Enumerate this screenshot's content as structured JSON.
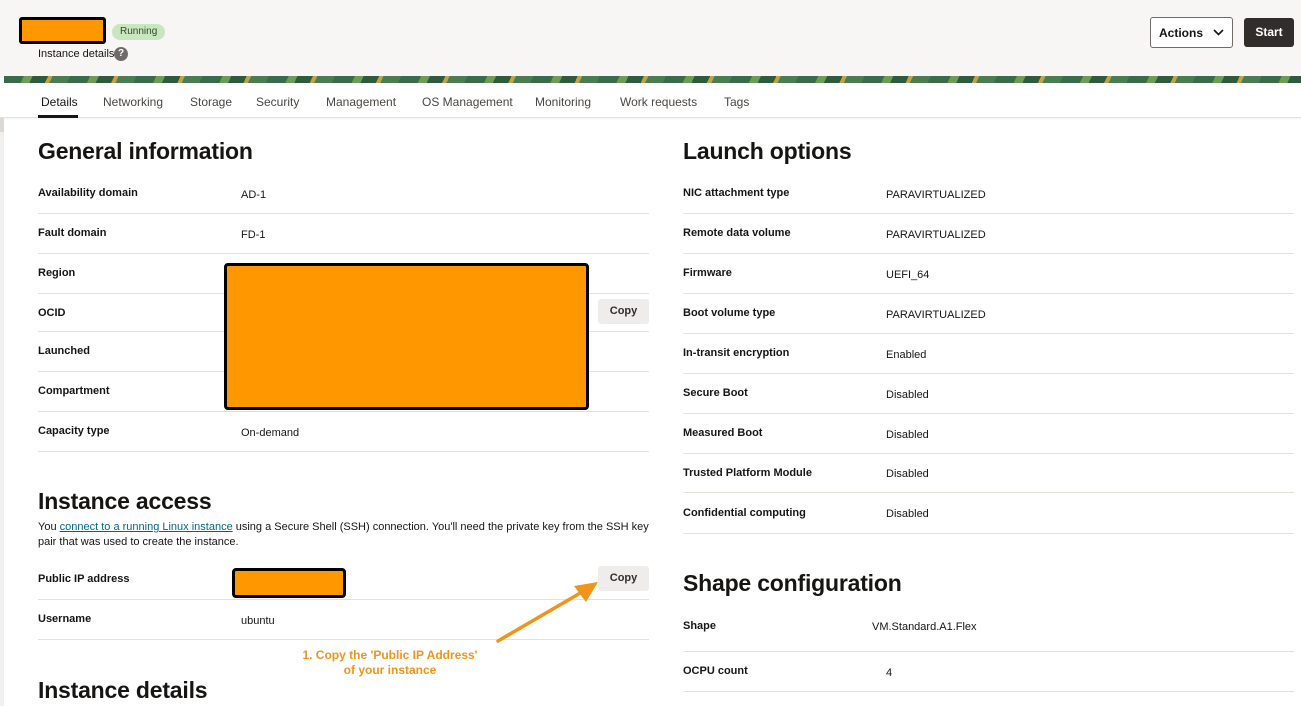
{
  "header": {
    "status": "Running",
    "subtitle": "Instance details",
    "help_glyph": "?",
    "actions_label": "Actions",
    "start_label": "Start"
  },
  "tabs": [
    "Details",
    "Networking",
    "Storage",
    "Security",
    "Management",
    "OS Management",
    "Monitoring",
    "Work requests",
    "Tags"
  ],
  "general": {
    "title": "General information",
    "rows": [
      {
        "label": "Availability domain",
        "value": "AD-1"
      },
      {
        "label": "Fault domain",
        "value": "FD-1"
      },
      {
        "label": "Region",
        "value": ""
      },
      {
        "label": "OCID",
        "value": ""
      },
      {
        "label": "Launched",
        "value": ""
      },
      {
        "label": "Compartment",
        "value": ""
      },
      {
        "label": "Capacity type",
        "value": "On-demand"
      }
    ],
    "copy_label": "Copy"
  },
  "access": {
    "title": "Instance access",
    "text_before": "You ",
    "link": "connect to a running Linux instance",
    "text_after": " using a Secure Shell (SSH) connection. You'll need the private key from the SSH key pair that was used to create the instance.",
    "rows": [
      {
        "label": "Public IP address",
        "value": ""
      },
      {
        "label": "Username",
        "value": "ubuntu"
      }
    ],
    "copy_label": "Copy"
  },
  "details_title": "Instance details",
  "launch": {
    "title": "Launch options",
    "rows": [
      {
        "label": "NIC attachment type",
        "value": "PARAVIRTUALIZED"
      },
      {
        "label": "Remote data volume",
        "value": "PARAVIRTUALIZED"
      },
      {
        "label": "Firmware",
        "value": "UEFI_64"
      },
      {
        "label": "Boot volume type",
        "value": "PARAVIRTUALIZED"
      },
      {
        "label": "In-transit encryption",
        "value": "Enabled"
      },
      {
        "label": "Secure Boot",
        "value": "Disabled"
      },
      {
        "label": "Measured Boot",
        "value": "Disabled"
      },
      {
        "label": "Trusted Platform Module",
        "value": "Disabled"
      },
      {
        "label": "Confidential computing",
        "value": "Disabled"
      }
    ]
  },
  "shape": {
    "title": "Shape configuration",
    "rows": [
      {
        "label": "Shape",
        "value": "VM.Standard.A1.Flex"
      },
      {
        "label": "OCPU count",
        "value": "4"
      }
    ]
  },
  "annotation": {
    "line1": "1. Copy the 'Public IP Address'",
    "line2": "of your instance"
  },
  "colors": {
    "redaction": "#ff9800",
    "annotation": "#f0941a",
    "status_badge": "#c9e6c0",
    "link": "#00688c"
  }
}
